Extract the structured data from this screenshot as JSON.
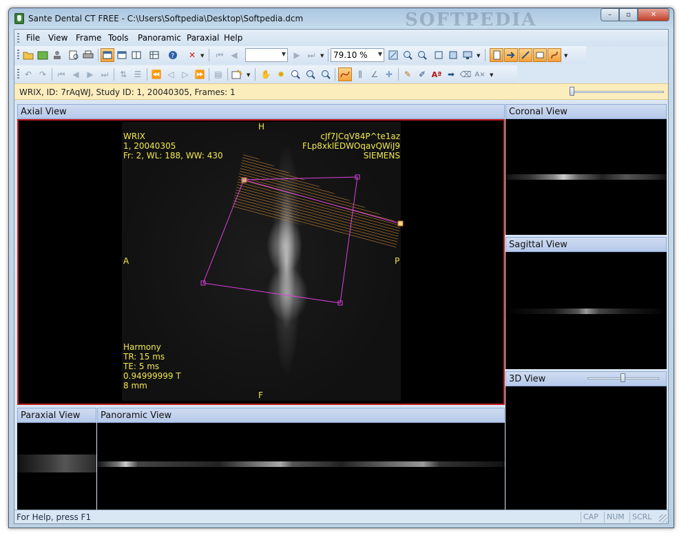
{
  "window": {
    "title": "Sante Dental CT FREE - C:\\Users\\Softpedia\\Desktop\\Softpedia.dcm",
    "watermark": "SOFTPEDIA",
    "buttons": {
      "minimize": "–",
      "maximize": "▫",
      "close": "✕"
    }
  },
  "menu": [
    "File",
    "View",
    "Frame",
    "Tools",
    "Panoramic",
    "Paraxial",
    "Help"
  ],
  "toolbar": {
    "zoom_value": "79.10 %",
    "frame_value": ""
  },
  "info": {
    "patient_text": "WRIX, ID: 7rAqWJ,   Study ID: 1, 20040305, Frames: 1",
    "frame_slider_position": 0.0
  },
  "views": {
    "axial": {
      "title": "Axial View",
      "top_left": [
        "WRIX",
        "1, 20040305",
        "Fr: 2, WL: 188, WW: 430"
      ],
      "top_right": [
        "cJf7JCqV84P^te1az",
        "FLp8xklEDWOqavQWiJ9",
        "SIEMENS"
      ],
      "bottom_left": [
        "Harmony",
        "TR: 15 ms",
        "TE: 5 ms",
        "0.94999999 T",
        "8 mm"
      ],
      "orient_top": "H",
      "orient_bottom": "F",
      "orient_left": "A",
      "orient_right": "P"
    },
    "coronal": {
      "title": "Coronal View"
    },
    "sagittal": {
      "title": "Sagittal View"
    },
    "three_d": {
      "title": "3D View",
      "slider_position": 0.5
    },
    "paraxial": {
      "title": "Paraxial View"
    },
    "panoramic": {
      "title": "Panoramic View"
    }
  },
  "status": {
    "help": "For Help, press F1",
    "indicators": [
      "CAP",
      "NUM",
      "SCRL"
    ]
  },
  "colors": {
    "overlay_text": "#f2e94d",
    "accent_orange": "#f5a13a",
    "selection_magenta": "#e040e0",
    "axial_border": "#c42020"
  }
}
